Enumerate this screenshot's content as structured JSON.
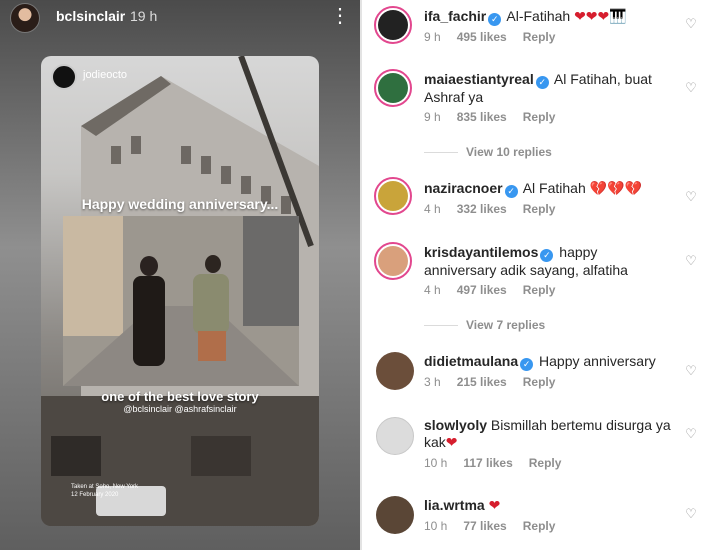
{
  "story": {
    "username": "bclsinclair",
    "time_ago": "19 h",
    "more_icon": "more-vertical-icon",
    "repost": {
      "username": "jodieocto",
      "headline": "Happy wedding anniversary...",
      "tagline": "one of the best love story",
      "tags": "@bclsinclair @ashrafsinclair",
      "location_line1": "Taken at Soho, New York",
      "location_line2": "12 February 2020"
    }
  },
  "comments": [
    {
      "username": "ifa_fachir",
      "verified": true,
      "text": "Al-Fatihah",
      "emoji": "❤❤❤🎹",
      "time": "9 h",
      "likes": "495 likes",
      "reply": "Reply"
    },
    {
      "username": "maiaestiantyreal",
      "verified": true,
      "text": "Al Fatihah, buat Ashraf ya",
      "emoji": "",
      "time": "9 h",
      "likes": "835 likes",
      "reply": "Reply",
      "view_replies": "View 10 replies"
    },
    {
      "username": "naziracnoer",
      "verified": true,
      "text": "Al Fatihah",
      "emoji": "💔💔💔",
      "time": "4 h",
      "likes": "332 likes",
      "reply": "Reply"
    },
    {
      "username": "krisdayantilemos",
      "verified": true,
      "text": "happy anniversary adik sayang, alfatiha",
      "emoji": "",
      "time": "4 h",
      "likes": "497 likes",
      "reply": "Reply",
      "view_replies": "View 7 replies"
    },
    {
      "username": "didietmaulana",
      "verified": true,
      "text": "Happy anniversary",
      "emoji": "",
      "time": "3 h",
      "likes": "215 likes",
      "reply": "Reply"
    },
    {
      "username": "slowlyoly",
      "verified": false,
      "text": "Bismillah bertemu disurga ya kak",
      "emoji": "❤",
      "time": "10 h",
      "likes": "117 likes",
      "reply": "Reply"
    },
    {
      "username": "lia.wrtma",
      "verified": false,
      "text": "",
      "emoji": "❤",
      "time": "10 h",
      "likes": "77 likes",
      "reply": "Reply"
    }
  ],
  "colors": {
    "verified_blue": "#3897f0",
    "story_ring": "#e2478e",
    "meta_gray": "#8e8e8e"
  }
}
